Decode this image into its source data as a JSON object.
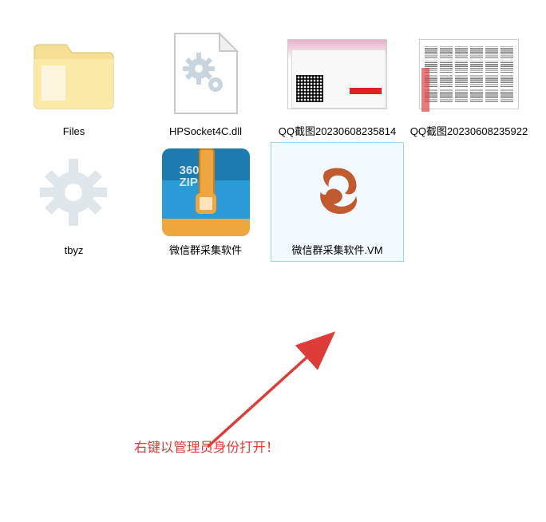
{
  "files": [
    {
      "name": "Files",
      "type": "folder"
    },
    {
      "name": "HPSocket4C.dll",
      "type": "dll"
    },
    {
      "name": "QQ截图20230608235814",
      "type": "screenshot-app"
    },
    {
      "name": "QQ截图20230608235922",
      "type": "screenshot-grid"
    },
    {
      "name": "tbyz",
      "type": "config"
    },
    {
      "name": "微信群采集软件",
      "type": "zip",
      "zip_badge_top": "360",
      "zip_badge_bottom": "ZIP"
    },
    {
      "name": "微信群采集软件.VM",
      "type": "vm",
      "selected": true
    }
  ],
  "annotation": {
    "text": "右键以管理员身份打开！",
    "color": "#de3c38"
  }
}
